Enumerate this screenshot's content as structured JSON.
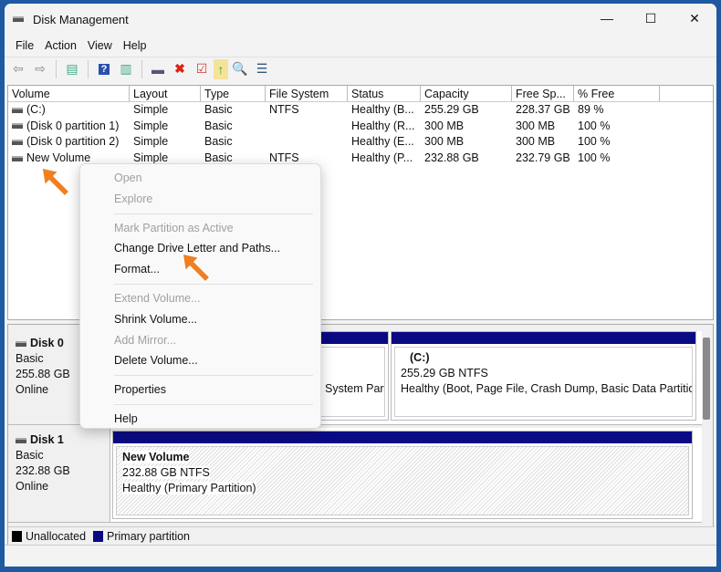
{
  "window": {
    "title": "Disk Management",
    "minimize": "—",
    "maximize": "☐",
    "close": "✕"
  },
  "menubar": [
    "File",
    "Action",
    "View",
    "Help"
  ],
  "toolbar": {
    "icons": [
      "back-icon",
      "forward-icon",
      "console-tree-icon",
      "help-icon",
      "action-pane-icon",
      "connect-icon",
      "delete-icon",
      "properties-icon",
      "import-icon",
      "search-icon",
      "list-icon"
    ]
  },
  "list": {
    "headers": [
      "Volume",
      "Layout",
      "Type",
      "File System",
      "Status",
      "Capacity",
      "Free Sp...",
      "% Free"
    ],
    "rows": [
      [
        "(C:)",
        "Simple",
        "Basic",
        "NTFS",
        "Healthy (B...",
        "255.29 GB",
        "228.37 GB",
        "89 %"
      ],
      [
        "(Disk 0 partition 1)",
        "Simple",
        "Basic",
        "",
        "Healthy (R...",
        "300 MB",
        "300 MB",
        "100 %"
      ],
      [
        "(Disk 0 partition 2)",
        "Simple",
        "Basic",
        "",
        "Healthy (E...",
        "300 MB",
        "300 MB",
        "100 %"
      ],
      [
        "New Volume",
        "Simple",
        "Basic",
        "NTFS",
        "Healthy (P...",
        "232.88 GB",
        "232.79 GB",
        "100 %"
      ]
    ]
  },
  "disks": [
    {
      "name": "Disk 0",
      "type": "Basic",
      "size": "255.88 GB",
      "state": "Online",
      "partitions": [
        {
          "label": "",
          "line1": "",
          "line2": "System Parti"
        },
        {
          "label": "(C:)",
          "line1": "255.29 GB NTFS",
          "line2": "Healthy (Boot, Page File, Crash Dump, Basic Data Partition)"
        }
      ]
    },
    {
      "name": "Disk 1",
      "type": "Basic",
      "size": "232.88 GB",
      "state": "Online",
      "partitions": [
        {
          "label": "New Volume",
          "line1": "232.88 GB NTFS",
          "line2": "Healthy (Primary Partition)"
        }
      ]
    }
  ],
  "legend": [
    {
      "label": "Unallocated",
      "color": "#000000"
    },
    {
      "label": "Primary partition",
      "color": "#0a0a84"
    }
  ],
  "context_menu": {
    "open": "Open",
    "explore": "Explore",
    "mark_active": "Mark Partition as Active",
    "change_letter": "Change Drive Letter and Paths...",
    "format": "Format...",
    "extend": "Extend Volume...",
    "shrink": "Shrink Volume...",
    "add_mirror": "Add Mirror...",
    "delete": "Delete Volume...",
    "properties": "Properties",
    "help": "Help"
  },
  "accent": "#f07f22"
}
